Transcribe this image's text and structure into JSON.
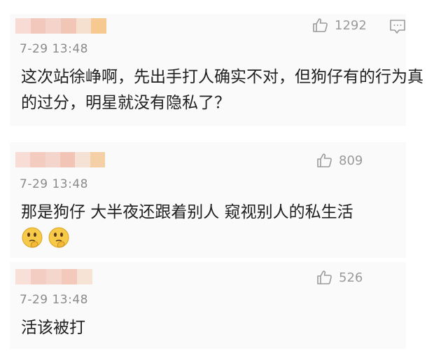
{
  "comments": [
    {
      "time": "7-29 13:48",
      "likes": "1292",
      "content": "这次站徐峥啊，先出手打人确实不对，但狗仔有的行为真的过分，明星就没有隐私了？",
      "has_reply_icon": true,
      "emojis": []
    },
    {
      "time": "7-29 13:48",
      "likes": "809",
      "content": "那是狗仔 大半夜还跟着别人 窥视别人的私生活",
      "emojis": [
        "thinking-emoji",
        "thinking-emoji"
      ]
    },
    {
      "time": "7-29 13:48",
      "likes": "526",
      "content": "活该被打",
      "emojis": []
    }
  ],
  "icons": {
    "like": "thumbs-up-icon",
    "reply": "comment-bubble-icon"
  },
  "colors": {
    "name_blur": [
      "#f6d6d0",
      "#f4c9bf",
      "#f3d3c9",
      "#f2c7b8",
      "#f5e0d0",
      "#f6c98f"
    ],
    "time": "#8a8a8a",
    "text": "#1f1f1f",
    "icon": "#9a9a9a"
  }
}
